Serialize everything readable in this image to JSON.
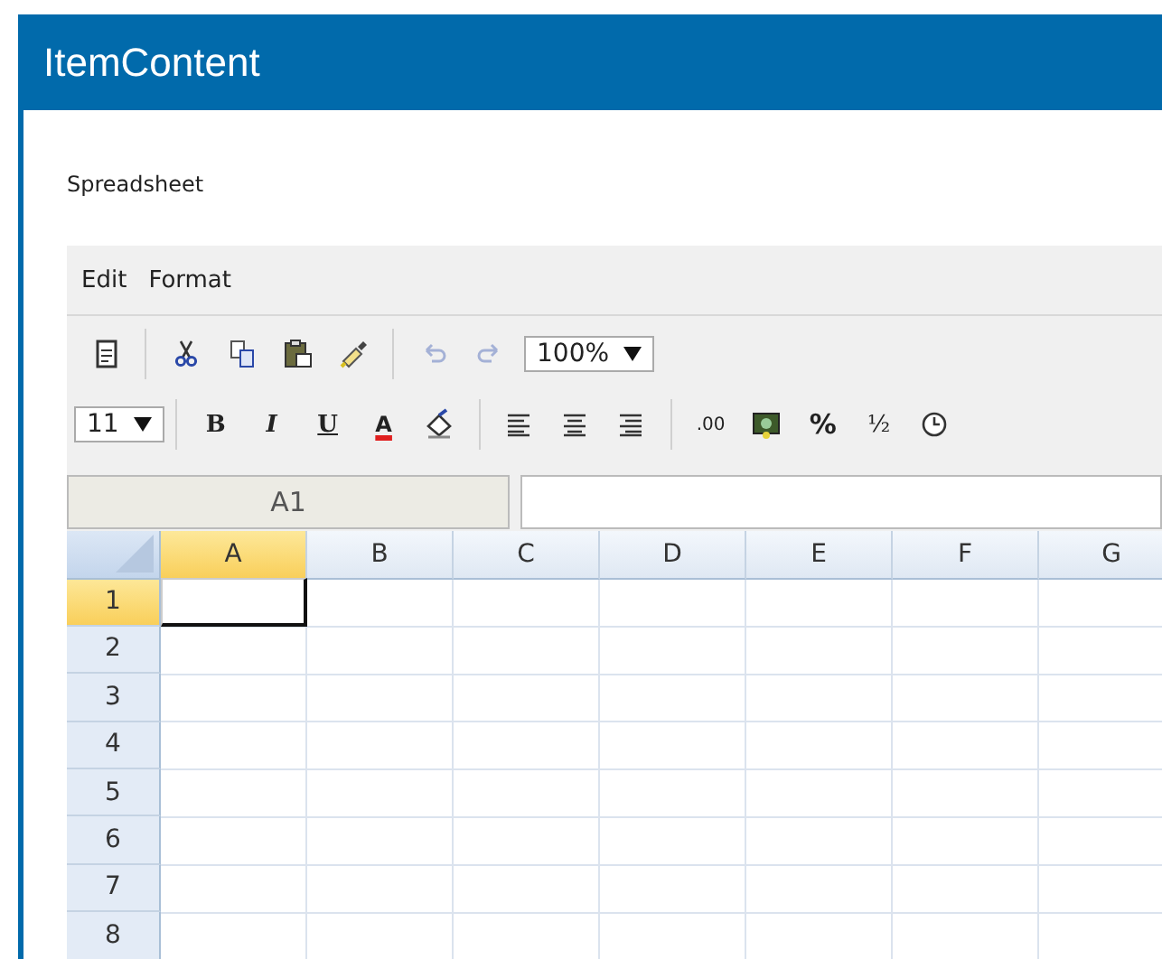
{
  "window": {
    "title": "ItemContent"
  },
  "section_label": "Spreadsheet",
  "menu": [
    {
      "label": "Edit"
    },
    {
      "label": "Format"
    }
  ],
  "toolbar_top": [
    {
      "kind": "new-page",
      "disabled": false
    },
    {
      "kind": "separator"
    },
    {
      "kind": "cut",
      "disabled": false
    },
    {
      "kind": "copy",
      "disabled": false
    },
    {
      "kind": "paste",
      "disabled": false
    },
    {
      "kind": "format-painter",
      "disabled": false
    },
    {
      "kind": "separator"
    },
    {
      "kind": "undo",
      "disabled": true
    },
    {
      "kind": "redo",
      "disabled": true
    },
    {
      "kind": "dropdown",
      "value": "100%"
    }
  ],
  "toolbar_bottom": [
    {
      "kind": "dropdown",
      "value": "11"
    },
    {
      "kind": "separator"
    },
    {
      "kind": "bold",
      "label": "B"
    },
    {
      "kind": "italic",
      "label": "I"
    },
    {
      "kind": "underline",
      "label": "U"
    },
    {
      "kind": "font-color",
      "label": "A"
    },
    {
      "kind": "fill"
    },
    {
      "kind": "separator"
    },
    {
      "kind": "align-left"
    },
    {
      "kind": "align-center"
    },
    {
      "kind": "align-right"
    },
    {
      "kind": "separator"
    },
    {
      "kind": "decimal",
      "label": ".00"
    },
    {
      "kind": "currency"
    },
    {
      "kind": "percent",
      "label": "%"
    },
    {
      "kind": "fraction",
      "label": "½"
    },
    {
      "kind": "time"
    }
  ],
  "name_box": "A1",
  "columns": [
    {
      "label": "A",
      "selected": true
    },
    {
      "label": "B",
      "selected": false
    },
    {
      "label": "C",
      "selected": false
    },
    {
      "label": "D",
      "selected": false
    },
    {
      "label": "E",
      "selected": false
    },
    {
      "label": "F",
      "selected": false
    },
    {
      "label": "G",
      "selected": false
    }
  ],
  "rows": [
    {
      "label": "1",
      "selected": true
    },
    {
      "label": "2",
      "selected": false
    },
    {
      "label": "3",
      "selected": false
    },
    {
      "label": "4",
      "selected": false
    },
    {
      "label": "5",
      "selected": false
    },
    {
      "label": "6",
      "selected": false
    },
    {
      "label": "7",
      "selected": false
    },
    {
      "label": "8",
      "selected": false
    }
  ]
}
